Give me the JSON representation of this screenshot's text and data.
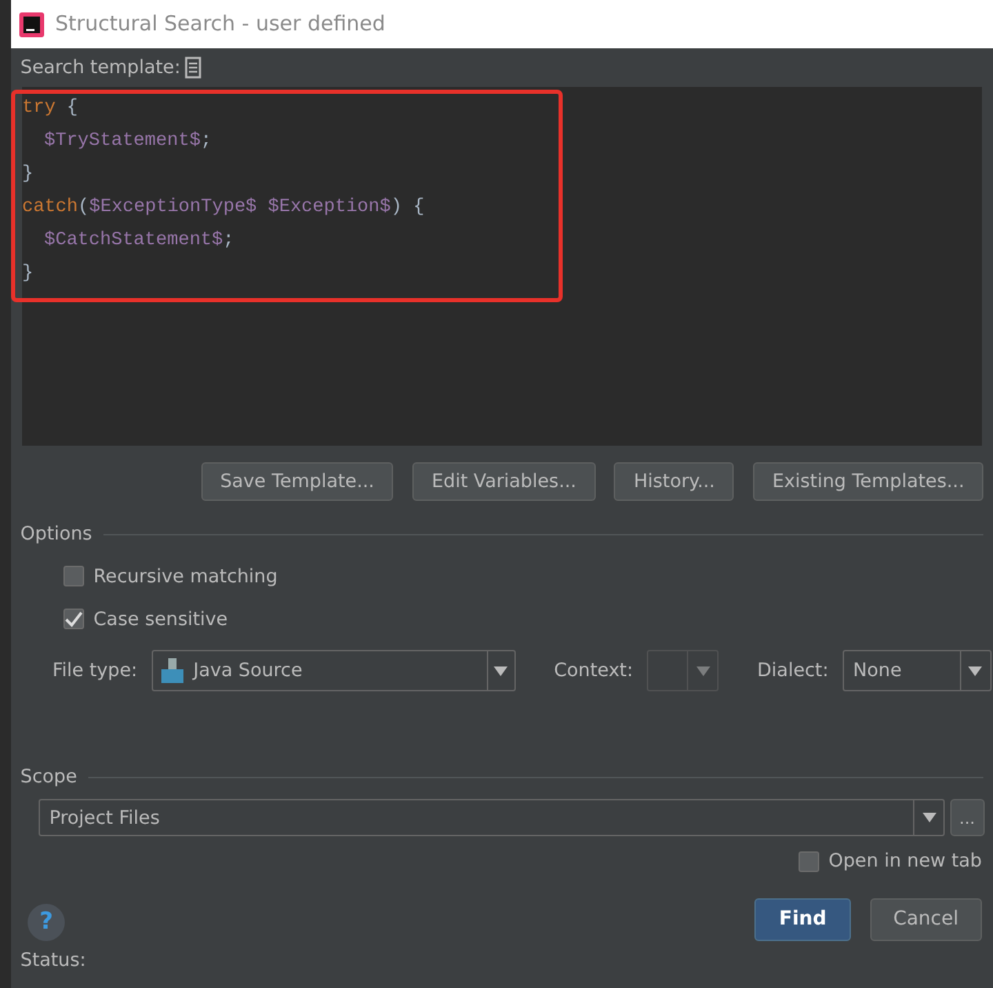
{
  "window": {
    "title": "Structural Search - user defined"
  },
  "template": {
    "label": "Search template:",
    "lines": [
      [
        {
          "kind": "keyword",
          "text": "try"
        },
        {
          "kind": "plain",
          "text": " {"
        }
      ],
      [
        {
          "kind": "variable",
          "text": "$TryStatement$"
        },
        {
          "kind": "plain",
          "text": ";"
        }
      ],
      [
        {
          "kind": "plain",
          "text": "}"
        }
      ],
      [
        {
          "kind": "keyword",
          "text": "catch"
        },
        {
          "kind": "plain",
          "text": "("
        },
        {
          "kind": "variable",
          "text": "$ExceptionType$ $Exception$"
        },
        {
          "kind": "plain",
          "text": ") {"
        }
      ],
      [
        {
          "kind": "variable",
          "text": "$CatchStatement$"
        },
        {
          "kind": "plain",
          "text": ";"
        }
      ],
      [
        {
          "kind": "plain",
          "text": "}"
        }
      ]
    ],
    "annotation": {
      "kind": "frame"
    }
  },
  "template_buttons": [
    "Save Template...",
    "Edit Variables...",
    "History...",
    "Existing Templates..."
  ],
  "options": {
    "title": "Options",
    "checkboxes": [
      {
        "label": "Recursive matching",
        "checked": false
      },
      {
        "label": "Case sensitive",
        "checked": true
      }
    ],
    "file_type": {
      "label": "File type:",
      "value": "Java Source"
    },
    "context": {
      "label": "Context:",
      "disabled": true
    },
    "dialect": {
      "label": "Dialect:",
      "value": "None"
    }
  },
  "scope": {
    "title": "Scope",
    "value": "Project Files",
    "more": "...",
    "open_in_new_tab": {
      "label": "Open in new tab",
      "checked": false
    }
  },
  "help": "?",
  "buttons": [
    {
      "label": "Find",
      "primary": true
    },
    {
      "label": "Cancel",
      "primary": false
    }
  ],
  "status": "Status:"
}
